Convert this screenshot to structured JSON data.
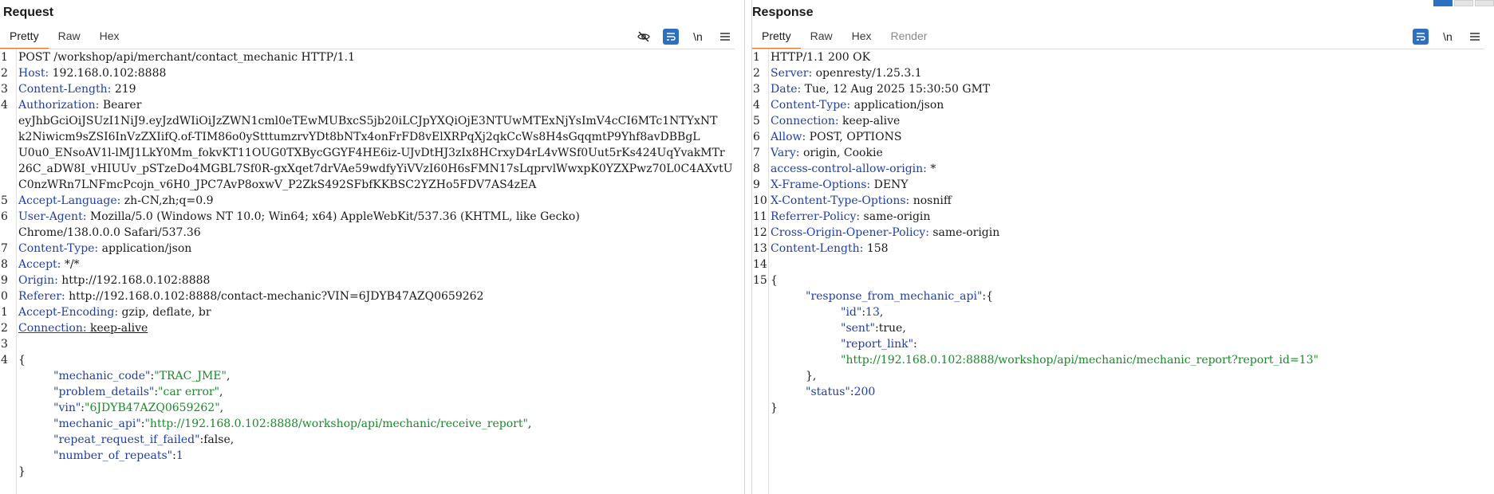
{
  "request": {
    "title": "Request",
    "tabs": [
      "Pretty",
      "Raw",
      "Hex"
    ],
    "lines": [
      {
        "n": "1",
        "segs": [
          {
            "t": "POST /workshop/api/merchant/contact_mechanic HTTP/1.1",
            "c": "hv"
          }
        ]
      },
      {
        "n": "2",
        "segs": [
          {
            "t": "Host: ",
            "c": "hn"
          },
          {
            "t": "192.168.0.102:8888",
            "c": "hv"
          }
        ]
      },
      {
        "n": "3",
        "segs": [
          {
            "t": "Content-Length: ",
            "c": "hn"
          },
          {
            "t": "219",
            "c": "hv"
          }
        ]
      },
      {
        "n": "4",
        "segs": [
          {
            "t": "Authorization: ",
            "c": "hn"
          },
          {
            "t": "Bearer",
            "c": "hv"
          }
        ]
      },
      {
        "n": "",
        "segs": [
          {
            "t": "eyJhbGciOiJSUzI1NiJ9.eyJzdWIiOiJzZWN1cml0eTEwMUBxcS5jb20iLCJpYXQiOjE3NTUwMTExNjYsImV4cCI6MTc1NTYxNT",
            "c": "hv"
          }
        ]
      },
      {
        "n": "",
        "segs": [
          {
            "t": "k2Niwicm9sZSI6InVzZXIifQ.of-TIM86o0yStttumzrvYDt8bNTx4onFrFD8vElXRPqXj2qkCcWs8H4sGqqmtP9Yhf8avDBBgL",
            "c": "hv"
          }
        ]
      },
      {
        "n": "",
        "segs": [
          {
            "t": "U0u0_ENsoAV1l-lMJ1LkY0Mm_fokvKT11OUG0TXBycGGYF4HE6iz-UJvDtHJ3zIx8HCrxyD4rL4vWSf0Uut5rKs424UqYvakMTr",
            "c": "hv"
          }
        ]
      },
      {
        "n": "",
        "segs": [
          {
            "t": "26C_aDW8I_vHIUUv_pSTzeDo4MGBL7Sf0R-gxXqet7drVAe59wdfyYiVVzI60H6sFMN17sLqprvlWwxpK0YZXPwz70L0C4AXvtU",
            "c": "hv"
          }
        ]
      },
      {
        "n": "",
        "segs": [
          {
            "t": "C0nzWRn7LNFmcPcojn_v6H0_JPC7AvP8oxwV_P2ZkS492SFbfKKBSC2YZHo5FDV7AS4zEA",
            "c": "hv"
          }
        ]
      },
      {
        "n": "5",
        "segs": [
          {
            "t": "Accept-Language: ",
            "c": "hn"
          },
          {
            "t": "zh-CN,zh;q=0.9",
            "c": "hv"
          }
        ]
      },
      {
        "n": "6",
        "segs": [
          {
            "t": "User-Agent: ",
            "c": "hn"
          },
          {
            "t": "Mozilla/5.0 (Windows NT 10.0; Win64; x64) AppleWebKit/537.36 (KHTML, like Gecko)",
            "c": "hv"
          }
        ]
      },
      {
        "n": "",
        "segs": [
          {
            "t": "Chrome/138.0.0.0 Safari/537.36",
            "c": "hv"
          }
        ]
      },
      {
        "n": "7",
        "segs": [
          {
            "t": "Content-Type: ",
            "c": "hn"
          },
          {
            "t": "application/json",
            "c": "hv"
          }
        ]
      },
      {
        "n": "8",
        "segs": [
          {
            "t": "Accept: ",
            "c": "hn"
          },
          {
            "t": "*/*",
            "c": "hv"
          }
        ]
      },
      {
        "n": "9",
        "segs": [
          {
            "t": "Origin: ",
            "c": "hn"
          },
          {
            "t": "http://192.168.0.102:8888",
            "c": "hv"
          }
        ]
      },
      {
        "n": "0",
        "segs": [
          {
            "t": "Referer: ",
            "c": "hn"
          },
          {
            "t": "http://192.168.0.102:8888/contact-mechanic?VIN=6JDYB47AZQ0659262",
            "c": "hv"
          }
        ]
      },
      {
        "n": "1",
        "segs": [
          {
            "t": "Accept-Encoding: ",
            "c": "hn"
          },
          {
            "t": "gzip, deflate, br",
            "c": "hv"
          }
        ]
      },
      {
        "n": "2",
        "segs": [
          {
            "t": "Connection: ",
            "c": "hn u"
          },
          {
            "t": "keep-alive",
            "c": "hv u"
          }
        ]
      },
      {
        "n": "3",
        "segs": []
      },
      {
        "n": "4",
        "segs": [
          {
            "t": "{",
            "c": "p"
          }
        ]
      },
      {
        "n": "",
        "ind": 1,
        "segs": [
          {
            "t": "\"mechanic_code\"",
            "c": "k"
          },
          {
            "t": ":",
            "c": "p"
          },
          {
            "t": "\"TRAC_JME\"",
            "c": "s"
          },
          {
            "t": ",",
            "c": "p"
          }
        ]
      },
      {
        "n": "",
        "ind": 1,
        "segs": [
          {
            "t": "\"problem_details\"",
            "c": "k"
          },
          {
            "t": ":",
            "c": "p"
          },
          {
            "t": "\"car error\"",
            "c": "s"
          },
          {
            "t": ",",
            "c": "p"
          }
        ]
      },
      {
        "n": "",
        "ind": 1,
        "segs": [
          {
            "t": "\"vin\"",
            "c": "k"
          },
          {
            "t": ":",
            "c": "p"
          },
          {
            "t": "\"6JDYB47AZQ0659262\"",
            "c": "s"
          },
          {
            "t": ",",
            "c": "p"
          }
        ]
      },
      {
        "n": "",
        "ind": 1,
        "segs": [
          {
            "t": "\"mechanic_api\"",
            "c": "k"
          },
          {
            "t": ":",
            "c": "p"
          },
          {
            "t": "\"http://192.168.0.102:8888/workshop/api/mechanic/receive_report\"",
            "c": "s"
          },
          {
            "t": ",",
            "c": "p"
          }
        ]
      },
      {
        "n": "",
        "ind": 1,
        "segs": [
          {
            "t": "\"repeat_request_if_failed\"",
            "c": "k"
          },
          {
            "t": ":false,",
            "c": "p"
          }
        ]
      },
      {
        "n": "",
        "ind": 1,
        "segs": [
          {
            "t": "\"number_of_repeats\"",
            "c": "k"
          },
          {
            "t": ":",
            "c": "p"
          },
          {
            "t": "1",
            "c": "n"
          }
        ]
      },
      {
        "n": "",
        "segs": [
          {
            "t": "}",
            "c": "p"
          }
        ]
      }
    ]
  },
  "response": {
    "title": "Response",
    "tabs": [
      "Pretty",
      "Raw",
      "Hex",
      "Render"
    ],
    "lines": [
      {
        "n": "1",
        "segs": [
          {
            "t": "HTTP/1.1 200 OK",
            "c": "hv"
          }
        ]
      },
      {
        "n": "2",
        "segs": [
          {
            "t": "Server: ",
            "c": "hn"
          },
          {
            "t": "openresty/1.25.3.1",
            "c": "hv"
          }
        ]
      },
      {
        "n": "3",
        "segs": [
          {
            "t": "Date: ",
            "c": "hn"
          },
          {
            "t": "Tue, 12 Aug 2025 15:30:50 GMT",
            "c": "hv"
          }
        ]
      },
      {
        "n": "4",
        "segs": [
          {
            "t": "Content-Type: ",
            "c": "hn"
          },
          {
            "t": "application/json",
            "c": "hv"
          }
        ]
      },
      {
        "n": "5",
        "segs": [
          {
            "t": "Connection: ",
            "c": "hn"
          },
          {
            "t": "keep-alive",
            "c": "hv"
          }
        ]
      },
      {
        "n": "6",
        "segs": [
          {
            "t": "Allow: ",
            "c": "hn"
          },
          {
            "t": "POST, OPTIONS",
            "c": "hv"
          }
        ]
      },
      {
        "n": "7",
        "segs": [
          {
            "t": "Vary: ",
            "c": "hn"
          },
          {
            "t": "origin, Cookie",
            "c": "hv"
          }
        ]
      },
      {
        "n": "8",
        "segs": [
          {
            "t": "access-control-allow-origin: ",
            "c": "hn"
          },
          {
            "t": "*",
            "c": "hv"
          }
        ]
      },
      {
        "n": "9",
        "segs": [
          {
            "t": "X-Frame-Options: ",
            "c": "hn"
          },
          {
            "t": "DENY",
            "c": "hv"
          }
        ]
      },
      {
        "n": "10",
        "segs": [
          {
            "t": "X-Content-Type-Options: ",
            "c": "hn"
          },
          {
            "t": "nosniff",
            "c": "hv"
          }
        ]
      },
      {
        "n": "11",
        "segs": [
          {
            "t": "Referrer-Policy: ",
            "c": "hn"
          },
          {
            "t": "same-origin",
            "c": "hv"
          }
        ]
      },
      {
        "n": "12",
        "segs": [
          {
            "t": "Cross-Origin-Opener-Policy: ",
            "c": "hn"
          },
          {
            "t": "same-origin",
            "c": "hv"
          }
        ]
      },
      {
        "n": "13",
        "segs": [
          {
            "t": "Content-Length: ",
            "c": "hn"
          },
          {
            "t": "158",
            "c": "hv"
          }
        ]
      },
      {
        "n": "14",
        "segs": []
      },
      {
        "n": "15",
        "segs": [
          {
            "t": "{",
            "c": "p"
          }
        ]
      },
      {
        "n": "",
        "ind": 1,
        "segs": [
          {
            "t": "\"response_from_mechanic_api\"",
            "c": "k"
          },
          {
            "t": ":{",
            "c": "p"
          }
        ]
      },
      {
        "n": "",
        "ind": 2,
        "segs": [
          {
            "t": "\"id\"",
            "c": "k"
          },
          {
            "t": ":",
            "c": "p"
          },
          {
            "t": "13",
            "c": "n"
          },
          {
            "t": ",",
            "c": "p"
          }
        ]
      },
      {
        "n": "",
        "ind": 2,
        "segs": [
          {
            "t": "\"sent\"",
            "c": "k"
          },
          {
            "t": ":true,",
            "c": "p"
          }
        ]
      },
      {
        "n": "",
        "ind": 2,
        "segs": [
          {
            "t": "\"report_link\"",
            "c": "k"
          },
          {
            "t": ":",
            "c": "p"
          }
        ]
      },
      {
        "n": "",
        "ind": 2,
        "segs": [
          {
            "t": "\"http://192.168.0.102:8888/workshop/api/mechanic/mechanic_report?report_id=13\"",
            "c": "s"
          }
        ]
      },
      {
        "n": "",
        "ind": 1,
        "segs": [
          {
            "t": "},",
            "c": "p"
          }
        ]
      },
      {
        "n": "",
        "ind": 1,
        "segs": [
          {
            "t": "\"status\"",
            "c": "k"
          },
          {
            "t": ":",
            "c": "p"
          },
          {
            "t": "200",
            "c": "n"
          }
        ]
      },
      {
        "n": "",
        "segs": [
          {
            "t": "}",
            "c": "p"
          }
        ]
      }
    ]
  },
  "toolbar": {
    "newline_label": "\\n",
    "icons": [
      "eye-slash-icon",
      "wrap-icon",
      "newline-icon",
      "menu-icon"
    ]
  },
  "colors": {
    "accent": "#e8702a",
    "active_tool": "#2d6fc0",
    "header_name": "#1f3fa6",
    "string": "#1a8a2a"
  }
}
